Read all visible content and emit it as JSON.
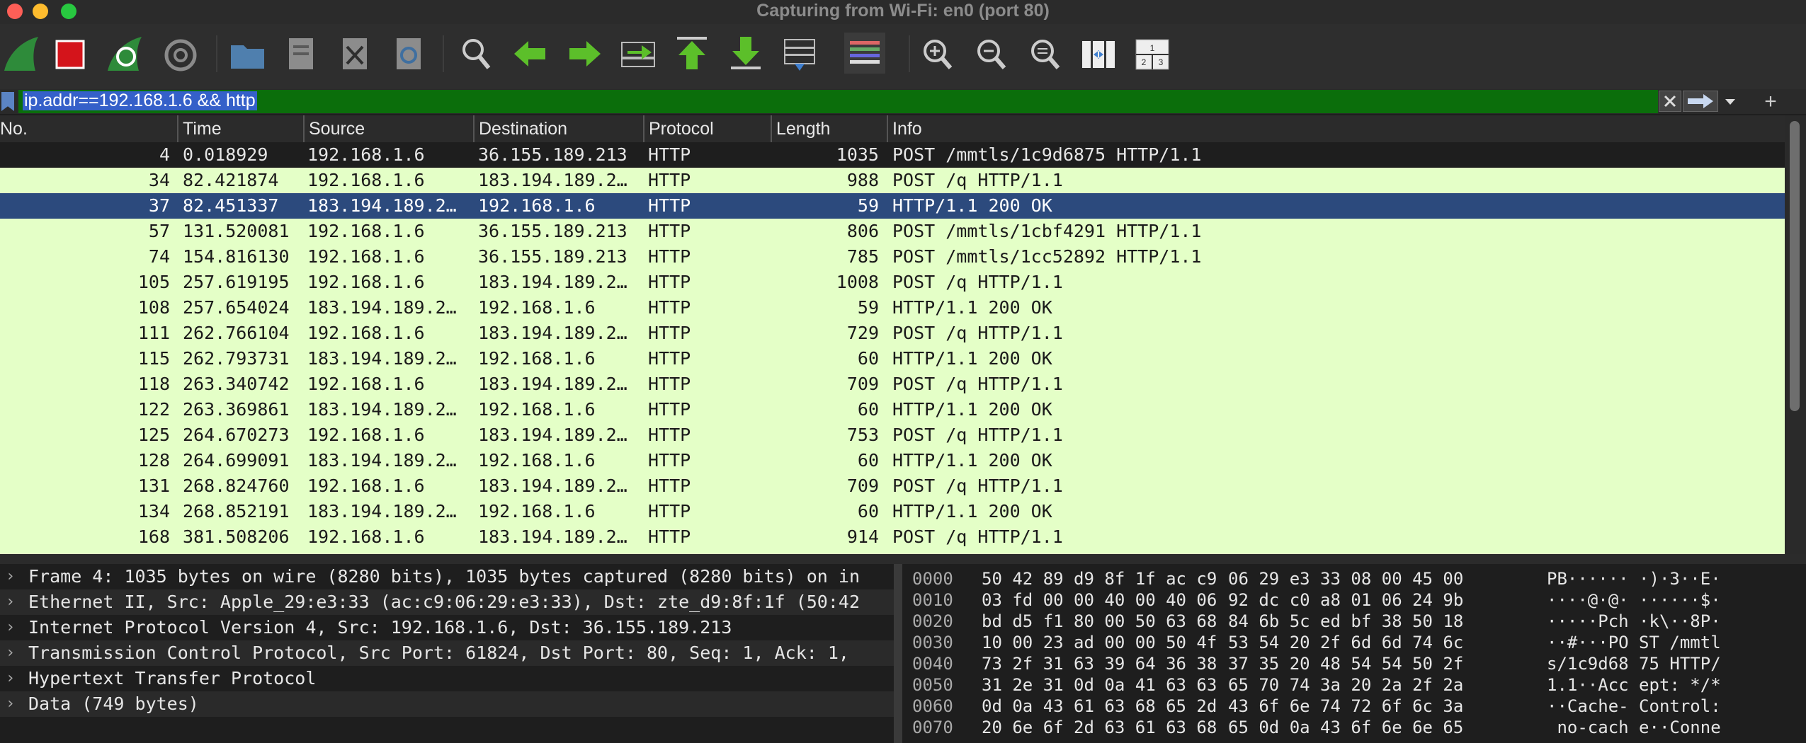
{
  "window": {
    "title": "Capturing from Wi-Fi: en0 (port 80)"
  },
  "toolbar": {
    "buttons": [
      "start-capture",
      "stop-capture",
      "restart-capture",
      "capture-options",
      "open-file",
      "save-file",
      "close-file",
      "reload-file",
      "find-packet",
      "go-back",
      "go-forward",
      "go-to-packet",
      "go-first",
      "go-last",
      "auto-scroll",
      "colorize",
      "zoom-in",
      "zoom-out",
      "zoom-normal",
      "resize-columns",
      "layout"
    ],
    "colors": {
      "fin_green": "#2e8b3a",
      "stop_red": "#d4141b",
      "arrow_green": "#5cbf2a"
    }
  },
  "filter": {
    "value": "ip.addr==192.168.1.6 && http",
    "add_label": "+"
  },
  "columns": {
    "no": "No.",
    "time": "Time",
    "source": "Source",
    "destination": "Destination",
    "protocol": "Protocol",
    "length": "Length",
    "info": "Info"
  },
  "packets": [
    {
      "no": "4",
      "time": "0.018929",
      "src": "192.168.1.6",
      "dst": "36.155.189.213",
      "proto": "HTTP",
      "len": "1035",
      "info": "POST /mmtls/1c9d6875 HTTP/1.1"
    },
    {
      "no": "34",
      "time": "82.421874",
      "src": "192.168.1.6",
      "dst": "183.194.189.2…",
      "proto": "HTTP",
      "len": "988",
      "info": "POST /q HTTP/1.1"
    },
    {
      "no": "37",
      "time": "82.451337",
      "src": "183.194.189.2…",
      "dst": "192.168.1.6",
      "proto": "HTTP",
      "len": "59",
      "info": "HTTP/1.1 200 OK"
    },
    {
      "no": "57",
      "time": "131.520081",
      "src": "192.168.1.6",
      "dst": "36.155.189.213",
      "proto": "HTTP",
      "len": "806",
      "info": "POST /mmtls/1cbf4291 HTTP/1.1"
    },
    {
      "no": "74",
      "time": "154.816130",
      "src": "192.168.1.6",
      "dst": "36.155.189.213",
      "proto": "HTTP",
      "len": "785",
      "info": "POST /mmtls/1cc52892 HTTP/1.1"
    },
    {
      "no": "105",
      "time": "257.619195",
      "src": "192.168.1.6",
      "dst": "183.194.189.2…",
      "proto": "HTTP",
      "len": "1008",
      "info": "POST /q HTTP/1.1"
    },
    {
      "no": "108",
      "time": "257.654024",
      "src": "183.194.189.2…",
      "dst": "192.168.1.6",
      "proto": "HTTP",
      "len": "59",
      "info": "HTTP/1.1 200 OK"
    },
    {
      "no": "111",
      "time": "262.766104",
      "src": "192.168.1.6",
      "dst": "183.194.189.2…",
      "proto": "HTTP",
      "len": "729",
      "info": "POST /q HTTP/1.1"
    },
    {
      "no": "115",
      "time": "262.793731",
      "src": "183.194.189.2…",
      "dst": "192.168.1.6",
      "proto": "HTTP",
      "len": "60",
      "info": "HTTP/1.1 200 OK"
    },
    {
      "no": "118",
      "time": "263.340742",
      "src": "192.168.1.6",
      "dst": "183.194.189.2…",
      "proto": "HTTP",
      "len": "709",
      "info": "POST /q HTTP/1.1"
    },
    {
      "no": "122",
      "time": "263.369861",
      "src": "183.194.189.2…",
      "dst": "192.168.1.6",
      "proto": "HTTP",
      "len": "60",
      "info": "HTTP/1.1 200 OK"
    },
    {
      "no": "125",
      "time": "264.670273",
      "src": "192.168.1.6",
      "dst": "183.194.189.2…",
      "proto": "HTTP",
      "len": "753",
      "info": "POST /q HTTP/1.1"
    },
    {
      "no": "128",
      "time": "264.699091",
      "src": "183.194.189.2…",
      "dst": "192.168.1.6",
      "proto": "HTTP",
      "len": "60",
      "info": "HTTP/1.1 200 OK"
    },
    {
      "no": "131",
      "time": "268.824760",
      "src": "192.168.1.6",
      "dst": "183.194.189.2…",
      "proto": "HTTP",
      "len": "709",
      "info": "POST /q HTTP/1.1"
    },
    {
      "no": "134",
      "time": "268.852191",
      "src": "183.194.189.2…",
      "dst": "192.168.1.6",
      "proto": "HTTP",
      "len": "60",
      "info": "HTTP/1.1 200 OK"
    },
    {
      "no": "168",
      "time": "381.508206",
      "src": "192.168.1.6",
      "dst": "183.194.189.2…",
      "proto": "HTTP",
      "len": "914",
      "info": "POST /q HTTP/1.1"
    }
  ],
  "details": [
    "Frame 4: 1035 bytes on wire (8280 bits), 1035 bytes captured (8280 bits) on in",
    "Ethernet II, Src: Apple_29:e3:33 (ac:c9:06:29:e3:33), Dst: zte_d9:8f:1f (50:42",
    "Internet Protocol Version 4, Src: 192.168.1.6, Dst: 36.155.189.213",
    "Transmission Control Protocol, Src Port: 61824, Dst Port: 80, Seq: 1, Ack: 1,",
    "Hypertext Transfer Protocol",
    "Data (749 bytes)"
  ],
  "bytes": [
    {
      "off": "0000",
      "h1": "50 42 89 d9 8f 1f ac c9",
      "h2": "06 29 e3 33 08 00 45 00",
      "asc": "PB······ ·)·3··E·"
    },
    {
      "off": "0010",
      "h1": "03 fd 00 00 40 00 40 06",
      "h2": "92 dc c0 a8 01 06 24 9b",
      "asc": "····@·@· ······$·"
    },
    {
      "off": "0020",
      "h1": "bd d5 f1 80 00 50 63 68",
      "h2": "84 6b 5c ed bf 38 50 18",
      "asc": "·····Pch ·k\\··8P·"
    },
    {
      "off": "0030",
      "h1": "10 00 23 ad 00 00 50 4f",
      "h2": "53 54 20 2f 6d 6d 74 6c",
      "asc": "··#···PO ST /mmtl"
    },
    {
      "off": "0040",
      "h1": "73 2f 31 63 39 64 36 38",
      "h2": "37 35 20 48 54 54 50 2f",
      "asc": "s/1c9d68 75 HTTP/"
    },
    {
      "off": "0050",
      "h1": "31 2e 31 0d 0a 41 63 63",
      "h2": "65 70 74 3a 20 2a 2f 2a",
      "asc": "1.1··Acc ept: */*"
    },
    {
      "off": "0060",
      "h1": "0d 0a 43 61 63 68 65 2d",
      "h2": "43 6f 6e 74 72 6f 6c 3a",
      "asc": "··Cache- Control:"
    },
    {
      "off": "0070",
      "h1": "20 6e 6f 2d 63 61 63 68",
      "h2": "65 0d 0a 43 6f 6e 6e 65",
      "asc": " no-cach e··Conne"
    }
  ]
}
